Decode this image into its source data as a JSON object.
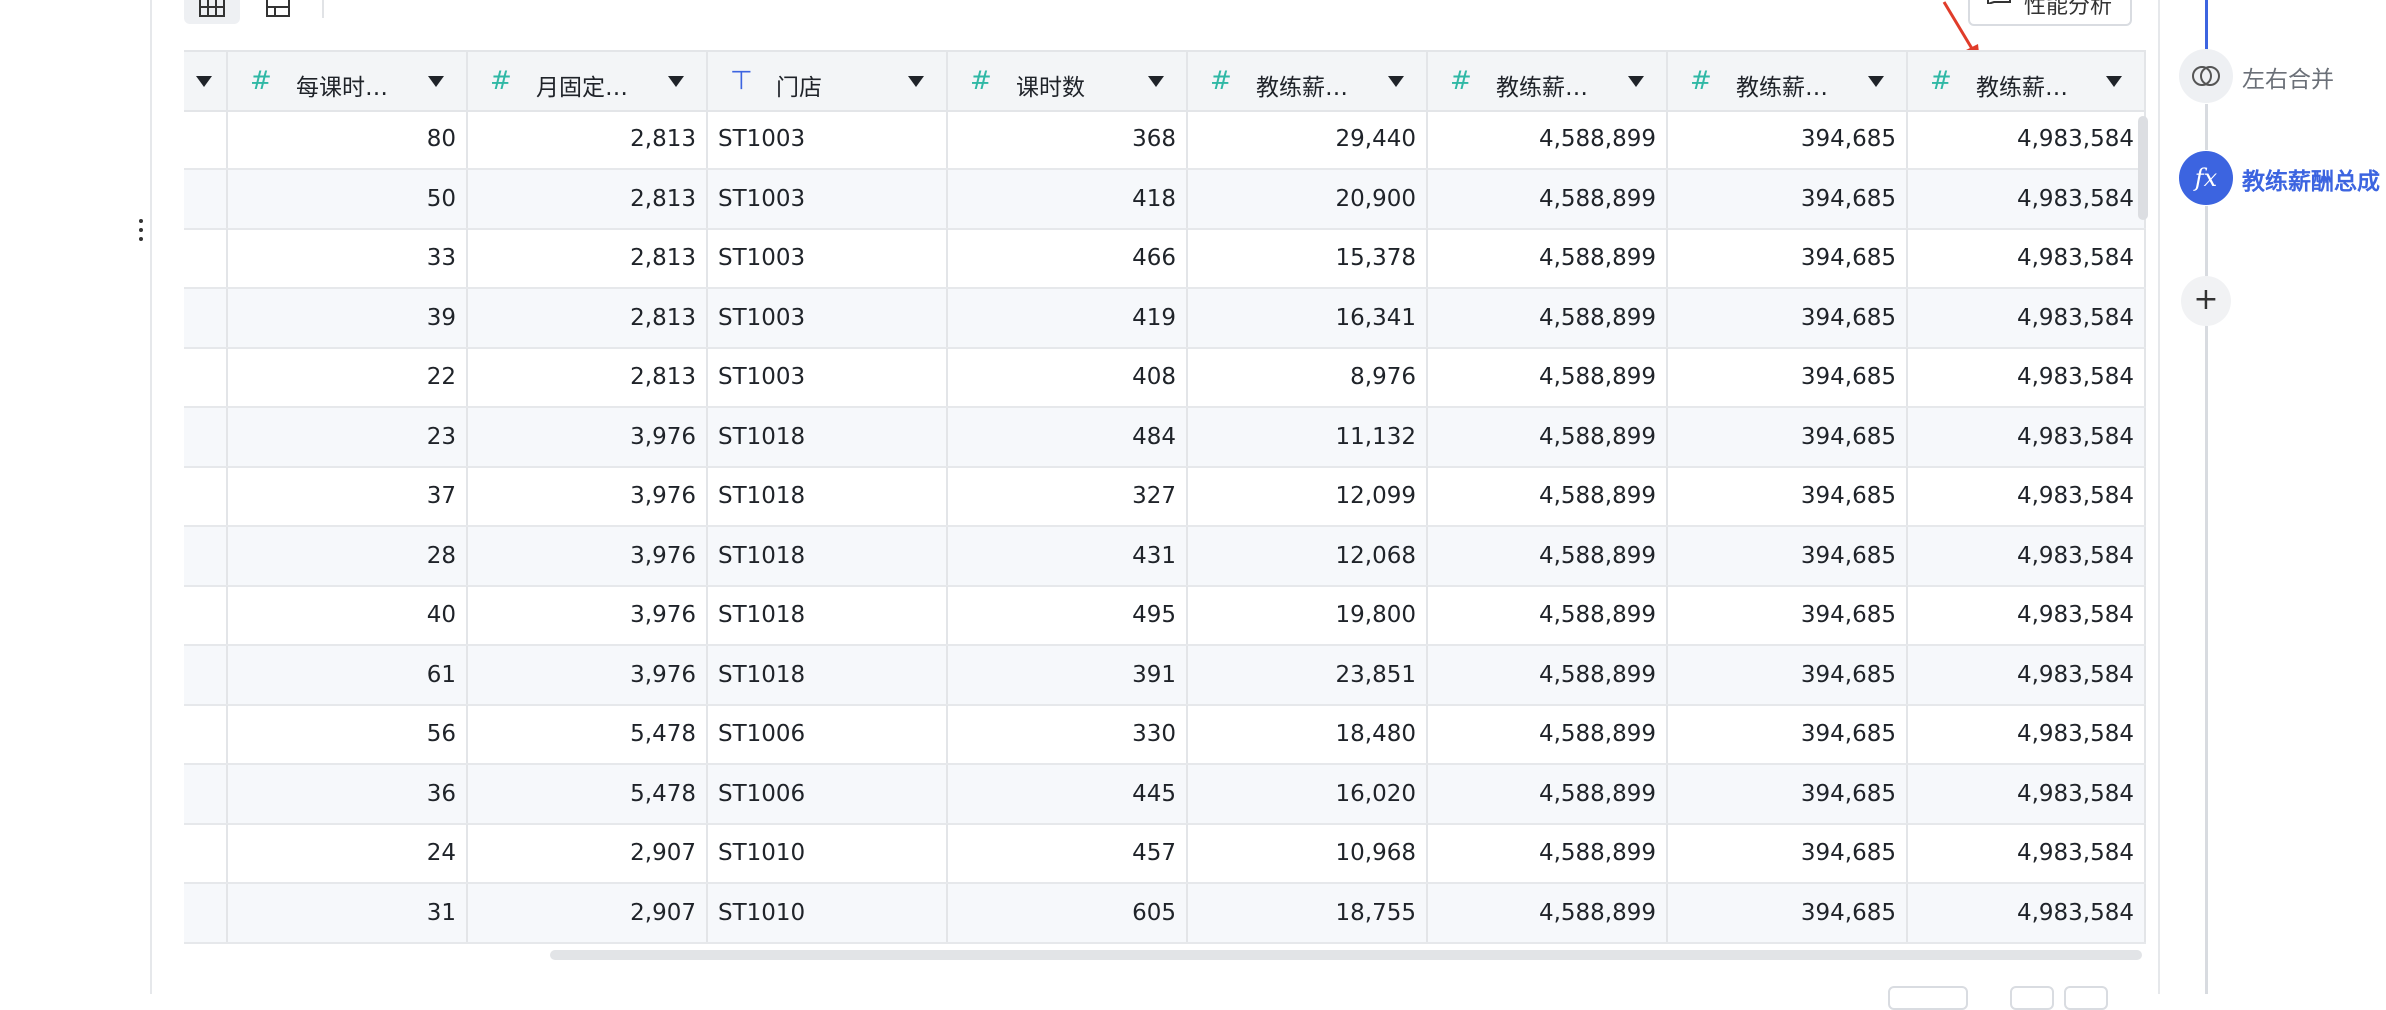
{
  "toolbar": {
    "performance_button": "性能分析"
  },
  "table": {
    "columns": [
      {
        "name": "",
        "type": "number"
      },
      {
        "name": "每课时…",
        "type": "number"
      },
      {
        "name": "月固定…",
        "type": "number"
      },
      {
        "name": "门店",
        "type": "text"
      },
      {
        "name": "课时数",
        "type": "number"
      },
      {
        "name": "教练薪…",
        "type": "number"
      },
      {
        "name": "教练薪…",
        "type": "number"
      },
      {
        "name": "教练薪…",
        "type": "number"
      },
      {
        "name": "教练薪…",
        "type": "number"
      }
    ],
    "rows": [
      [
        "80",
        "2,813",
        "ST1003",
        "368",
        "29,440",
        "4,588,899",
        "394,685",
        "4,983,584"
      ],
      [
        "50",
        "2,813",
        "ST1003",
        "418",
        "20,900",
        "4,588,899",
        "394,685",
        "4,983,584"
      ],
      [
        "33",
        "2,813",
        "ST1003",
        "466",
        "15,378",
        "4,588,899",
        "394,685",
        "4,983,584"
      ],
      [
        "39",
        "2,813",
        "ST1003",
        "419",
        "16,341",
        "4,588,899",
        "394,685",
        "4,983,584"
      ],
      [
        "22",
        "2,813",
        "ST1003",
        "408",
        "8,976",
        "4,588,899",
        "394,685",
        "4,983,584"
      ],
      [
        "23",
        "3,976",
        "ST1018",
        "484",
        "11,132",
        "4,588,899",
        "394,685",
        "4,983,584"
      ],
      [
        "37",
        "3,976",
        "ST1018",
        "327",
        "12,099",
        "4,588,899",
        "394,685",
        "4,983,584"
      ],
      [
        "28",
        "3,976",
        "ST1018",
        "431",
        "12,068",
        "4,588,899",
        "394,685",
        "4,983,584"
      ],
      [
        "40",
        "3,976",
        "ST1018",
        "495",
        "19,800",
        "4,588,899",
        "394,685",
        "4,983,584"
      ],
      [
        "61",
        "3,976",
        "ST1018",
        "391",
        "23,851",
        "4,588,899",
        "394,685",
        "4,983,584"
      ],
      [
        "56",
        "5,478",
        "ST1006",
        "330",
        "18,480",
        "4,588,899",
        "394,685",
        "4,983,584"
      ],
      [
        "36",
        "5,478",
        "ST1006",
        "445",
        "16,020",
        "4,588,899",
        "394,685",
        "4,983,584"
      ],
      [
        "24",
        "2,907",
        "ST1010",
        "457",
        "10,968",
        "4,588,899",
        "394,685",
        "4,983,584"
      ],
      [
        "31",
        "2,907",
        "ST1010",
        "605",
        "18,755",
        "4,588,899",
        "394,685",
        "4,983,584"
      ]
    ]
  },
  "flow": {
    "nodes": [
      {
        "label": "左右合并",
        "icon": "merge-icon",
        "state": "inactive"
      },
      {
        "label": "教练薪酬总成",
        "icon": "formula-icon",
        "state": "active"
      },
      {
        "label": "",
        "icon": "add-icon",
        "state": "add"
      }
    ]
  },
  "colors": {
    "accent": "#3c64e0",
    "number_type_icon": "#2fb8a5",
    "header_bg": "#f3f5f7",
    "alt_row_bg": "#f6f8fb",
    "annotation_arrow": "#e03c2a"
  }
}
